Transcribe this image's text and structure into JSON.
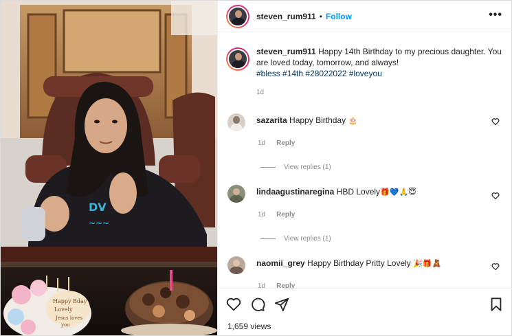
{
  "post": {
    "username": "steven_rum911",
    "follow_label": "Follow",
    "separator": "•",
    "more_label": "•••",
    "caption": {
      "username": "steven_rum911",
      "text": "Happy 14th Birthday to my precious daughter. You are loved today, tomorrow, and always!",
      "hashtags": "#bless #14th #28022022 #loveyou",
      "time": "1d"
    }
  },
  "comments": [
    {
      "username": "sazarita",
      "text": "Happy Birthday",
      "emoji": "🎂",
      "time": "1d",
      "reply_label": "Reply",
      "view_replies": "View replies (1)",
      "avatar_color": "#d8cfc6"
    },
    {
      "username": "lindaagustinaregina",
      "text": "HBD Lovely",
      "emoji": "🎁💙🙏😇",
      "time": "1d",
      "reply_label": "Reply",
      "view_replies": "View replies (1)",
      "avatar_color": "#8a8f7a"
    },
    {
      "username": "naomii_grey",
      "text": "Happy Birthday Pritty Lovely",
      "emoji": "🎉🎁🧸",
      "time": "1d",
      "reply_label": "Reply",
      "avatar_color": "#b9a89c"
    }
  ],
  "footer": {
    "views": "1,659 views"
  },
  "icons": {
    "like": "heart-icon",
    "comment": "comment-icon",
    "share": "share-icon",
    "save": "bookmark-icon"
  },
  "colors": {
    "link_blue": "#0095f6",
    "hashtag_blue": "#00376b",
    "meta_gray": "#8e8e8e",
    "text_dark": "#262626"
  }
}
